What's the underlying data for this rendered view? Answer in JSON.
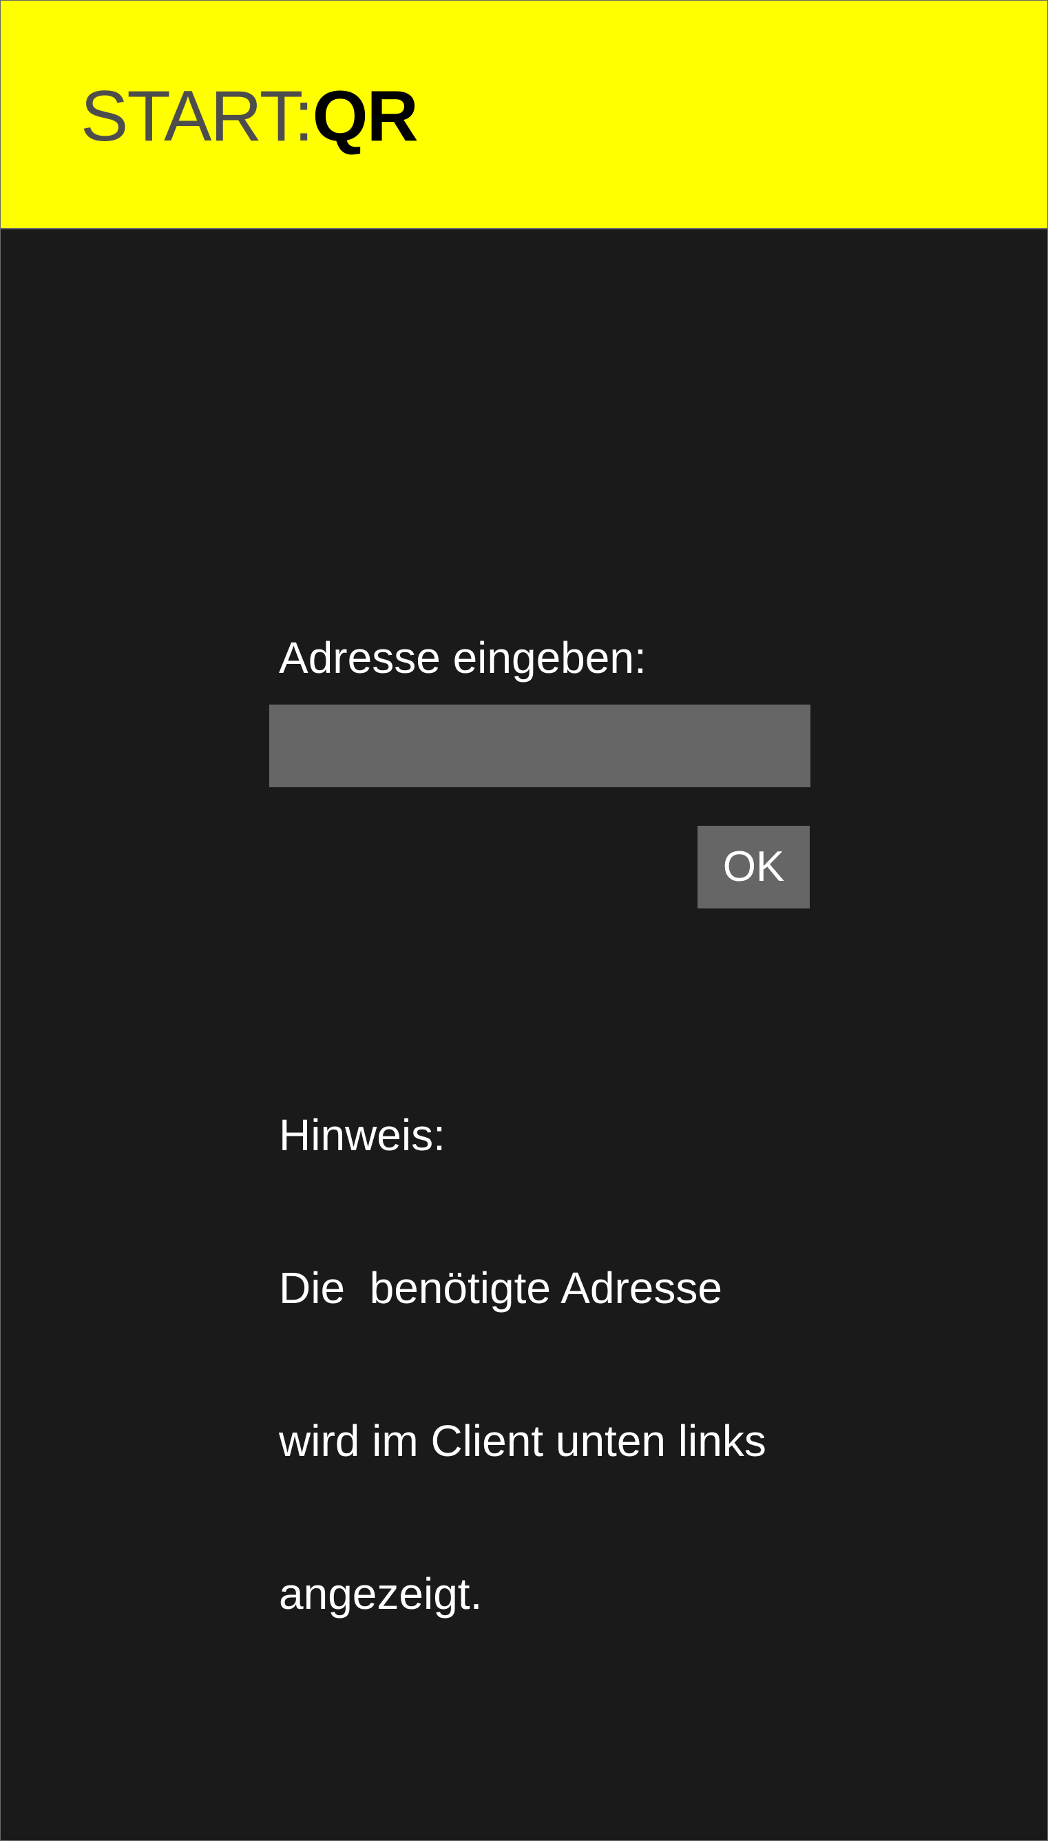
{
  "header": {
    "brand_start": "START:",
    "brand_qr": "QR",
    "background_color": "#ffff00"
  },
  "form": {
    "address_label": "Adresse eingeben:",
    "address_value": "",
    "ok_label": "OK"
  },
  "hint": {
    "lines": [
      "Hinweis:",
      "Die  benötigte Adresse",
      "wird im Client unten links",
      "angezeigt."
    ]
  },
  "colors": {
    "background": "#1a1a1a",
    "input_background": "#666666",
    "text": "#ffffff"
  }
}
